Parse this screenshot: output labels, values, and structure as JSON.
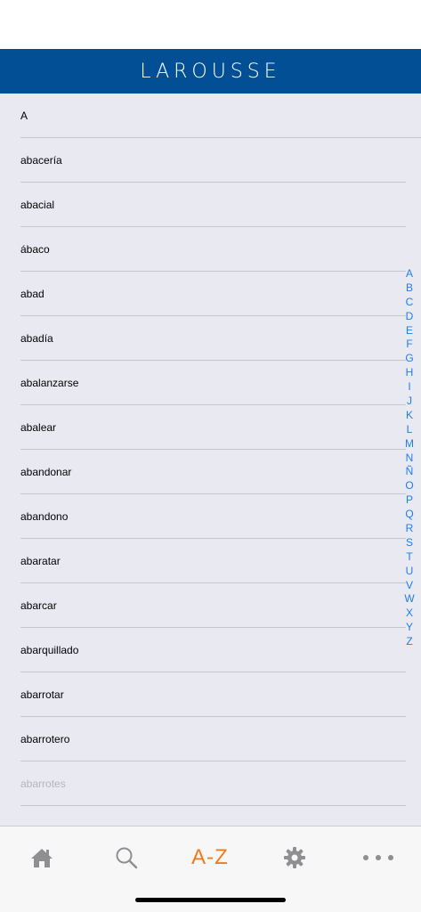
{
  "header": {
    "brand": "LAROUSSE"
  },
  "list": {
    "section": "A",
    "items": [
      "abacería",
      "abacial",
      "ábaco",
      "abad",
      "abadía",
      "abalanzarse",
      "abalear",
      "abandonar",
      "abandono",
      "abaratar",
      "abarcar",
      "abarquillado",
      "abarrotar",
      "abarrotero",
      "abarrotes"
    ]
  },
  "alphabet_index": [
    "A",
    "B",
    "C",
    "D",
    "E",
    "F",
    "G",
    "H",
    "I",
    "J",
    "K",
    "L",
    "M",
    "N",
    "Ñ",
    "O",
    "P",
    "Q",
    "R",
    "S",
    "T",
    "U",
    "V",
    "W",
    "X",
    "Y",
    "Z"
  ],
  "tabs": {
    "home_icon": "home-icon",
    "search_icon": "search-icon",
    "az_label": "A-Z",
    "settings_icon": "gear-icon",
    "more_icon": "more-icon",
    "active": "A-Z"
  },
  "colors": {
    "header_bg": "#024f95",
    "list_bg": "#e9e9f2",
    "index_letter": "#1e7ef0",
    "tab_active": "#f27a1a",
    "tab_inactive": "#8e8e93"
  }
}
